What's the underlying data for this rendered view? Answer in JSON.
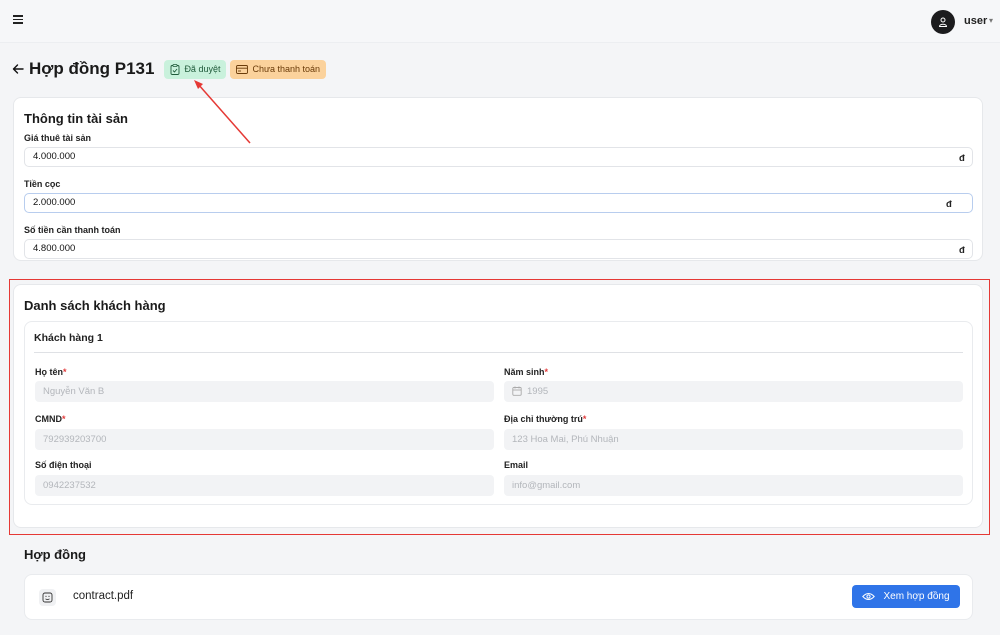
{
  "header": {
    "user_name": "user"
  },
  "page": {
    "title": "Hợp đồng P131",
    "badges": {
      "approved": "Đã duyệt",
      "payment": "Chưa thanh toán"
    }
  },
  "asset_info": {
    "title": "Thông tin tài sản",
    "fields": [
      {
        "label": "Giá thuê tài sản",
        "value": "4.000.000",
        "currency": "đ"
      },
      {
        "label": "Tiền cọc",
        "value": "2.000.000",
        "currency": "đ"
      },
      {
        "label": "Số tiền cần thanh toán",
        "value": "4.800.000",
        "currency": "đ"
      }
    ]
  },
  "customers": {
    "title": "Danh sách khách hàng",
    "items": [
      {
        "title": "Khách hàng 1",
        "full_name": {
          "label": "Họ tên",
          "required": "*",
          "placeholder": "Nguyễn Văn B"
        },
        "birth_year": {
          "label": "Năm sinh",
          "required": "*",
          "placeholder": "1995"
        },
        "id_number": {
          "label": "CMND",
          "required": "*",
          "placeholder": "792939203700"
        },
        "address": {
          "label": "Địa chỉ thường trú",
          "required": "*",
          "placeholder": "123 Hoa Mai, Phú Nhuận"
        },
        "phone": {
          "label": "Số điện thoại",
          "placeholder": "0942237532"
        },
        "email": {
          "label": "Email",
          "placeholder": "info@gmail.com"
        }
      }
    ]
  },
  "contract": {
    "title": "Hợp đồng",
    "file_name": "contract.pdf",
    "view_button": "Xem hợp đồng"
  },
  "colors": {
    "primary": "#2f74e8",
    "approved_badge": "#c9f1dc",
    "unpaid_badge": "#fbd29c",
    "annotation_red": "#e53935"
  }
}
